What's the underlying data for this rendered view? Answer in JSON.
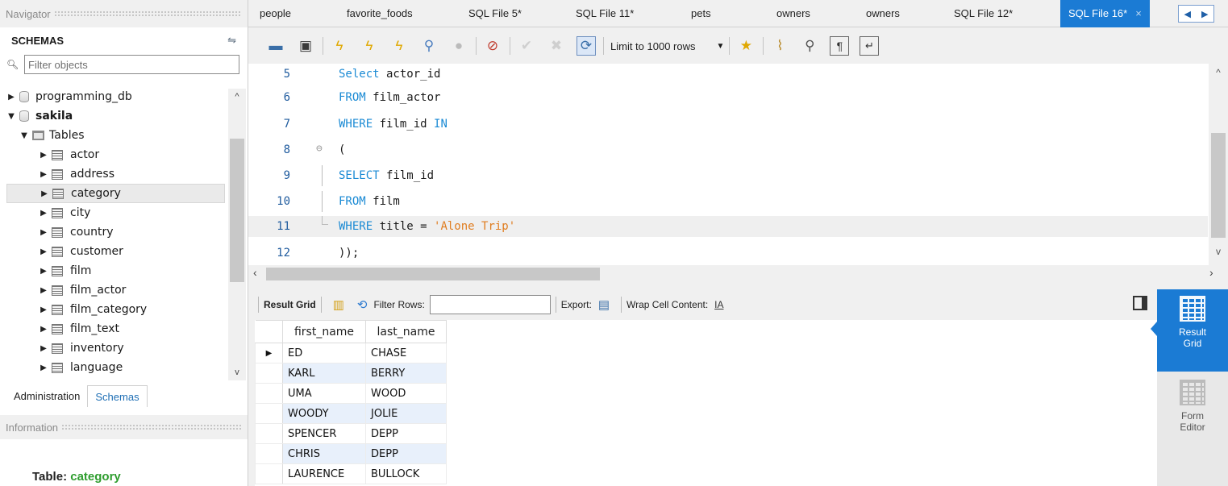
{
  "navigator": {
    "header": "Navigator",
    "schemas_title": "SCHEMAS",
    "filter_placeholder": "Filter objects",
    "tree": {
      "db1": "programming_db",
      "db2": "sakila",
      "tables_folder": "Tables",
      "tables": [
        "actor",
        "address",
        "category",
        "city",
        "country",
        "customer",
        "film",
        "film_actor",
        "film_category",
        "film_text",
        "inventory",
        "language"
      ],
      "selected_table": "category"
    },
    "tabs": {
      "administration": "Administration",
      "schemas": "Schemas"
    },
    "info_header": "Information",
    "info_table_prefix": "Table:",
    "info_table_name": "category"
  },
  "tabs": {
    "items": [
      "people",
      "favorite_foods",
      "SQL File 5*",
      "SQL File 11*",
      "pets",
      "owners",
      "owners",
      "SQL File 12*"
    ],
    "active": "SQL File 16*",
    "close": "×"
  },
  "toolbar": {
    "limit_label": "Limit to 1000 rows"
  },
  "editor": {
    "lines": [
      {
        "n": "5",
        "code": ""
      },
      {
        "n": "6",
        "code": ""
      },
      {
        "n": "7",
        "code": ""
      },
      {
        "n": "8",
        "code": ""
      },
      {
        "n": "9",
        "code": ""
      },
      {
        "n": "10",
        "code": ""
      },
      {
        "n": "11",
        "code": ""
      },
      {
        "n": "12",
        "code": ""
      }
    ],
    "tokens": {
      "l5_kw": "Select",
      "l5_rest": " actor_id",
      "l6_kw": "FROM",
      "l6_rest": " film_actor",
      "l7_kw1": "WHERE",
      "l7_mid": " film_id ",
      "l7_kw2": "IN",
      "l8": "(",
      "l9_kw": "SELECT",
      "l9_rest": " film_id",
      "l10_kw": "FROM",
      "l10_rest": " film",
      "l11_kw": "WHERE",
      "l11_mid": " title = ",
      "l11_str": "'Alone Trip'",
      "l12": "));"
    }
  },
  "result": {
    "result_grid": "Result Grid",
    "filter_rows": "Filter Rows:",
    "export": "Export:",
    "wrap": "Wrap Cell Content:",
    "columns": [
      "first_name",
      "last_name"
    ],
    "rows": [
      [
        "ED",
        "CHASE"
      ],
      [
        "KARL",
        "BERRY"
      ],
      [
        "UMA",
        "WOOD"
      ],
      [
        "WOODY",
        "JOLIE"
      ],
      [
        "SPENCER",
        "DEPP"
      ],
      [
        "CHRIS",
        "DEPP"
      ],
      [
        "LAURENCE",
        "BULLOCK"
      ]
    ]
  },
  "side_panel": {
    "result_grid_l1": "Result",
    "result_grid_l2": "Grid",
    "form_editor_l1": "Form",
    "form_editor_l2": "Editor"
  },
  "colors": {
    "accent": "#1b7bd4",
    "keyword": "#1a8ad4",
    "string": "#e07d20",
    "selected_row_alt": "#e8f0fb"
  }
}
